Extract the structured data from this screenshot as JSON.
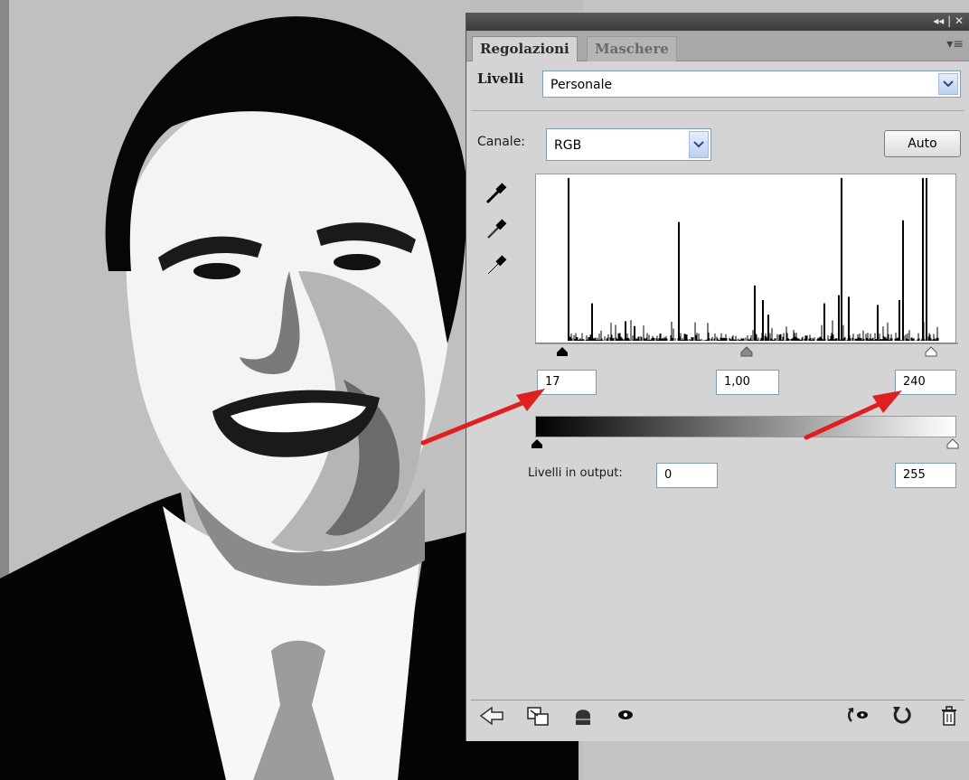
{
  "panel": {
    "tabs": [
      {
        "label": "Regolazioni",
        "active": true
      },
      {
        "label": "Maschere",
        "active": false
      }
    ],
    "adjustment_label": "Livelli",
    "preset_value": "Personale",
    "channel_label": "Canale:",
    "channel_value": "RGB",
    "auto_label": "Auto",
    "input_levels": {
      "black": "17",
      "gamma": "1,00",
      "white": "240"
    },
    "output_label": "Livelli in output:",
    "output_levels": {
      "black": "0",
      "white": "255"
    },
    "footer_icons": [
      "back-arrow-icon",
      "clip-to-layer-icon",
      "layer-visibility-mask-icon",
      "eye-icon",
      "view-previous-state-icon",
      "reset-icon",
      "trash-icon"
    ]
  },
  "colors": {
    "annotation_arrow": "#e02020",
    "panel_bg": "#d4d4d4"
  }
}
